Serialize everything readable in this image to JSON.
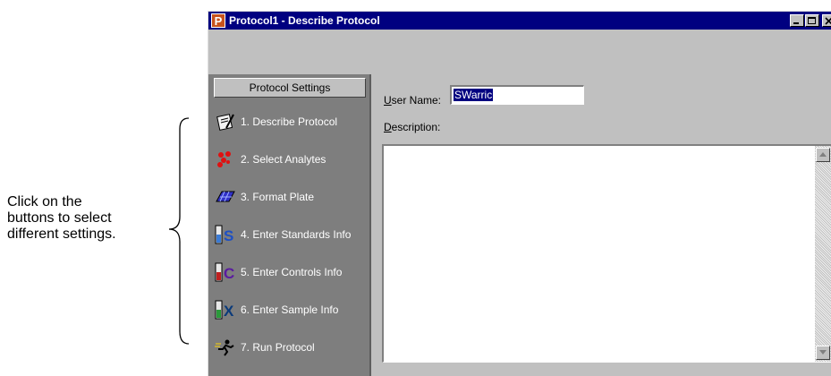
{
  "annotation": {
    "lines": [
      "Click on the",
      "buttons to select",
      "different settings."
    ]
  },
  "window": {
    "title": "Protocol1 - Describe Protocol",
    "app_icon_letter": "P",
    "title_bar_color": "#000080"
  },
  "sidebar": {
    "header": "Protocol Settings",
    "items": [
      {
        "label": "1. Describe Protocol",
        "icon": "describe-protocol-icon"
      },
      {
        "label": "2. Select Analytes",
        "icon": "select-analytes-icon"
      },
      {
        "label": "3. Format Plate",
        "icon": "format-plate-icon"
      },
      {
        "label": "4. Enter Standards Info",
        "icon": "standards-icon"
      },
      {
        "label": "5. Enter Controls Info",
        "icon": "controls-icon"
      },
      {
        "label": "6. Enter Sample Info",
        "icon": "sample-icon"
      },
      {
        "label": "7. Run Protocol",
        "icon": "run-protocol-icon"
      }
    ]
  },
  "form": {
    "user_name_label_first": "U",
    "user_name_label_rest": "ser Name:",
    "user_name_value": "SWarric",
    "description_label_first": "D",
    "description_label_rest": "escription:",
    "description_value": ""
  }
}
